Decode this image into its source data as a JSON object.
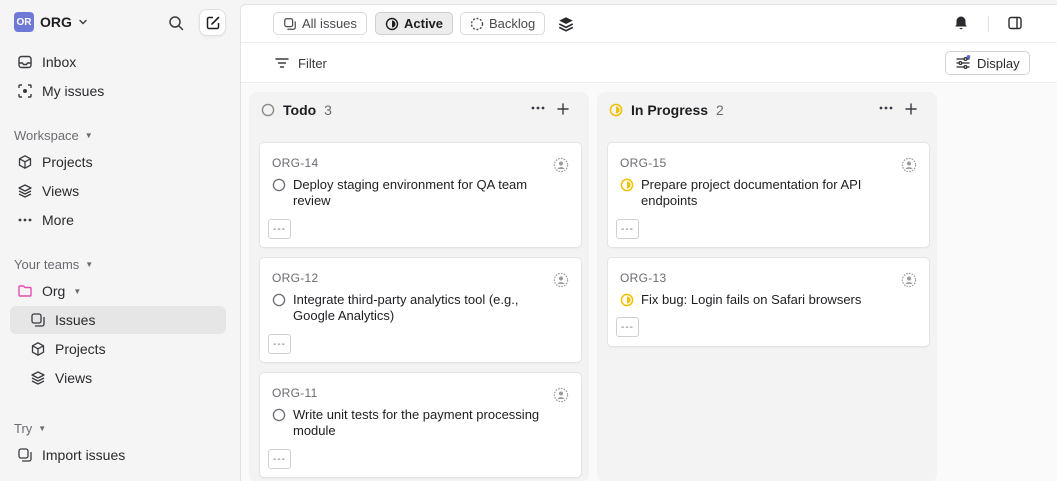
{
  "workspace": {
    "initials": "OR",
    "name": "ORG"
  },
  "nav": {
    "inbox": "Inbox",
    "my_issues": "My issues"
  },
  "workspace_section": {
    "label": "Workspace",
    "projects": "Projects",
    "views": "Views",
    "more": "More"
  },
  "teams_section": {
    "label": "Your teams",
    "team_name": "Org",
    "issues": "Issues",
    "projects": "Projects",
    "views": "Views"
  },
  "try_section": {
    "label": "Try",
    "import_issues": "Import issues"
  },
  "topbar": {
    "all_issues": "All issues",
    "active": "Active",
    "backlog": "Backlog"
  },
  "filterbar": {
    "filter": "Filter",
    "display": "Display"
  },
  "columns": [
    {
      "title": "Todo",
      "count": "3",
      "status": "todo",
      "cards": [
        {
          "id": "ORG-14",
          "title": "Deploy staging environment for QA team review",
          "more": "---"
        },
        {
          "id": "ORG-12",
          "title": "Integrate third-party analytics tool (e.g., Google Analytics)",
          "more": "---"
        },
        {
          "id": "ORG-11",
          "title": "Write unit tests for the payment processing module",
          "more": "---"
        }
      ]
    },
    {
      "title": "In Progress",
      "count": "2",
      "status": "in-progress",
      "cards": [
        {
          "id": "ORG-15",
          "title": "Prepare project documentation for API endpoints",
          "more": "---"
        },
        {
          "id": "ORG-13",
          "title": "Fix bug: Login fails on Safari browsers",
          "more": "---"
        }
      ]
    }
  ],
  "colors": {
    "accent": "#6e79d6",
    "in_progress": "#f2c200",
    "team": "#e84bb0",
    "notification_dot": "#5e6ad2"
  }
}
